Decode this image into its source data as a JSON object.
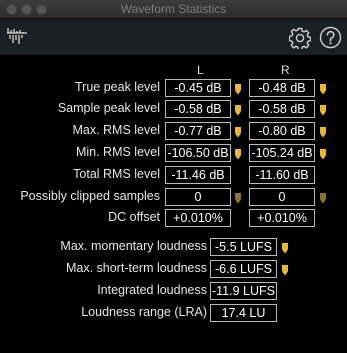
{
  "window": {
    "title": "Waveform Statistics"
  },
  "toolbar": {
    "logo_icon": "waveform-logo-icon",
    "settings_icon": "gear-icon",
    "help_icon": "help-icon"
  },
  "columns": {
    "left": "L",
    "right": "R"
  },
  "stats": [
    {
      "label": "True peak level",
      "left": "-0.45 dB",
      "right": "-0.48 dB",
      "marker": true,
      "marker_color": "#e8b63c"
    },
    {
      "label": "Sample peak level",
      "left": "-0.58 dB",
      "right": "-0.58 dB",
      "marker": true,
      "marker_color": "#e8b63c"
    },
    {
      "label": "Max. RMS level",
      "left": "-0.77 dB",
      "right": "-0.80 dB",
      "marker": true,
      "marker_color": "#e8b63c"
    },
    {
      "label": "Min. RMS level",
      "left": "-106.50 dB",
      "right": "-105.24 dB",
      "marker": true,
      "marker_color": "#e8b63c"
    },
    {
      "label": "Total RMS level",
      "left": "-11.46 dB",
      "right": "-11.60 dB",
      "marker": false
    },
    {
      "label": "Possibly clipped samples",
      "left": "0",
      "right": "0",
      "marker": true,
      "marker_color": "#8a7232"
    },
    {
      "label": "DC offset",
      "left": "+0.010%",
      "right": "+0.010%",
      "marker": false
    }
  ],
  "loudness": [
    {
      "label": "Max. momentary loudness",
      "value": "-5.5 LUFS",
      "marker": true
    },
    {
      "label": "Max. short-term loudness",
      "value": "-6.6 LUFS",
      "marker": true
    },
    {
      "label": "Integrated loudness",
      "value": "-11.9 LUFS",
      "marker": false
    },
    {
      "label": "Loudness range (LRA)",
      "value": "17.4 LU",
      "marker": false
    }
  ],
  "colors": {
    "marker": "#e8b63c",
    "marker_dim": "#8a7232",
    "toolbar": "#1b2026",
    "border": "#b9b9b9"
  }
}
